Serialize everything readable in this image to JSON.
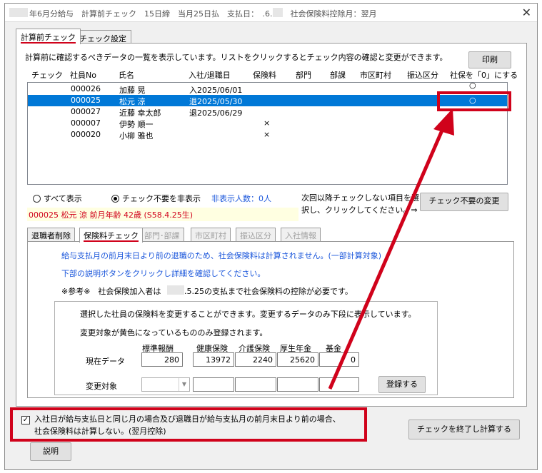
{
  "title": "年6月分給与　計算前チェック　15日締　当月25日払　支払日：　.6.25　社会保険料控除月：翌月",
  "tabs": [
    {
      "label": "計算前チェック"
    },
    {
      "label": "チェック設定"
    }
  ],
  "description": "計算前に確認するべきデータの一覧を表示しています。リストをクリックするとチェック内容の確認と変更ができます。",
  "print_button": "印刷",
  "columns": [
    "チェック",
    "社員No",
    "氏名",
    "入社/退職日",
    "保険料",
    "部門",
    "部課",
    "市区町村",
    "振込区分",
    "社保を「0」にする"
  ],
  "rows": [
    {
      "no": "000026",
      "name": "加藤 晃",
      "date": "入2025/06/01",
      "ins": "",
      "zero": "○"
    },
    {
      "no": "000025",
      "name": "松元 涼",
      "date": "退2025/05/30",
      "ins": "",
      "zero": "○"
    },
    {
      "no": "000027",
      "name": "近藤 幸太郎",
      "date": "退2025/06/29",
      "ins": "",
      "zero": ""
    },
    {
      "no": "000007",
      "name": "伊勢 順一",
      "date": "",
      "ins": "×",
      "zero": ""
    },
    {
      "no": "000020",
      "name": "小柳 雅也",
      "date": "",
      "ins": "×",
      "zero": ""
    }
  ],
  "filter": {
    "show_all": "すべて表示",
    "hide_unneeded": "チェック不要を非表示",
    "hidden_count": "非表示人数：0人",
    "hint_line1": "次回以降チェックしない項目を選",
    "hint_line2": "択し、クリックしてください。⇒",
    "change_button": "チェック不要の変更"
  },
  "selected_info": "000025 松元 涼 前月年齢 42歳 (S58.4.25生)",
  "sub_tabs": [
    "退職者削除",
    "保険料チェック",
    "部門･部課",
    "市区町村",
    "振込区分",
    "入社情報"
  ],
  "messages": {
    "line1": "給与支払月の前月末日より前の退職のため、社会保険料は計算されません。(一部計算対象)",
    "line2": "下部の説明ボタンをクリックし詳細を確認してください。",
    "line3_pre": "※参考※　社会保険加入者は",
    "line3_post": ".5.25の支払まで社会保険料の控除が必要です。"
  },
  "group": {
    "line1": "選択した社員の保険料を変更することができます。変更するデータのみ下段に表示しています。",
    "line2": "変更対象が黄色になっているもののみ登録されます。",
    "col_headers": [
      "標準報酬",
      "健康保険",
      "介護保険",
      "厚生年金",
      "基金"
    ],
    "current_label": "現在データ",
    "current_values": [
      "280",
      "13972",
      "2240",
      "25620",
      "0"
    ],
    "target_label": "変更対象",
    "register_button": "登録する"
  },
  "footer": {
    "checkbox_line1": "入社日が給与支払日と同じ月の場合及び退職日が給与支払月の前月末日より前の場合、",
    "checkbox_line2": "社会保険料は計算しない。(翌月控除)",
    "checkbox_checked": "✓",
    "finish_button": "チェックを終了し計算する",
    "explain_button": "説明"
  },
  "accent_red": "#d0021b",
  "selection_blue": "#0078d7"
}
